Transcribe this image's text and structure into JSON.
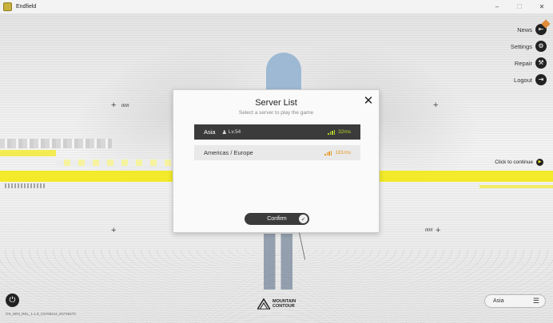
{
  "window": {
    "title": "Endfield",
    "minimize_icon": "–",
    "maximize_icon": "☐",
    "close_icon": "✕"
  },
  "side_menu": [
    {
      "label": "News",
      "icon": "news-icon",
      "glyph": "⇤"
    },
    {
      "label": "Settings",
      "icon": "gear-icon",
      "glyph": "⚙"
    },
    {
      "label": "Repair",
      "icon": "wrench-icon",
      "glyph": "⚒"
    },
    {
      "label": "Logout",
      "icon": "logout-icon",
      "glyph": "⇥"
    }
  ],
  "click_to_continue": "Click to continue",
  "decor_tag": "//////",
  "modal": {
    "title": "Server List",
    "subtitle": "Select a server to play the game",
    "confirm_label": "Confirm",
    "servers": [
      {
        "name": "Asia",
        "level": "Lv.54",
        "ping": "32ms",
        "quality": "good",
        "selected": true
      },
      {
        "name": "Americas / Europe",
        "level": "",
        "ping": "181ms",
        "quality": "ok",
        "selected": false
      }
    ]
  },
  "footer": {
    "version": "OS_WIN_REL_1.1.9_C5769412_E5726270",
    "logo_line1": "MOUNTAIN",
    "logo_line2": "CONTOUR",
    "region": "Asia"
  },
  "colors": {
    "accent_yellow": "#f2ea2a",
    "ping_good": "#b6d52b",
    "ping_ok": "#e59a2b",
    "dark": "#3b3b3b"
  }
}
